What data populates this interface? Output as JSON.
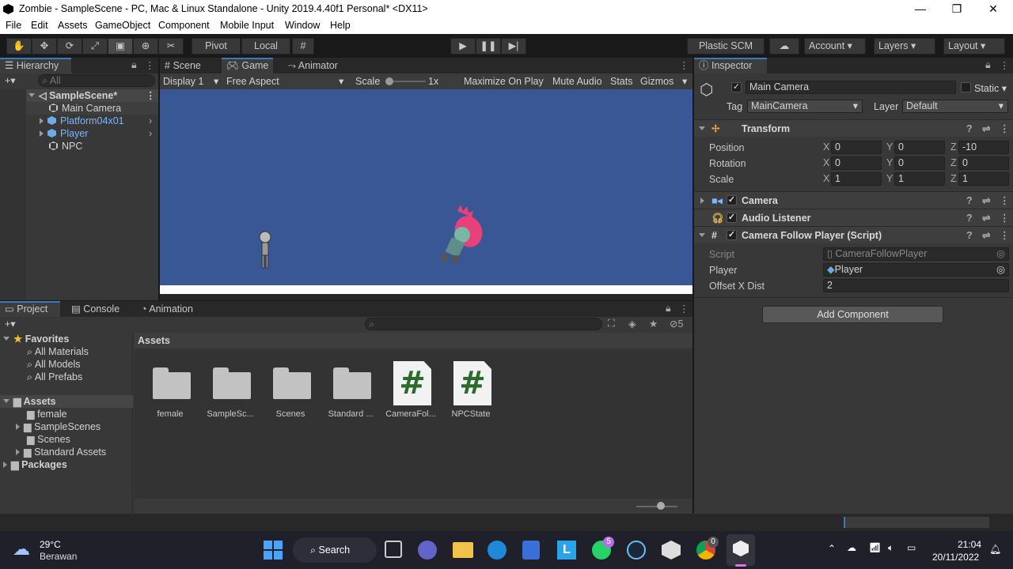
{
  "window": {
    "title": "Zombie - SampleScene - PC, Mac & Linux Standalone - Unity 2019.4.40f1 Personal* <DX11>",
    "minimize": "—",
    "maximize": "❐",
    "close": "✕"
  },
  "menu": [
    "File",
    "Edit",
    "Assets",
    "GameObject",
    "Component",
    "Mobile Input",
    "Window",
    "Help"
  ],
  "toolbar": {
    "pivot": "Pivot",
    "local": "Local",
    "plastic": "Plastic SCM",
    "account": "Account",
    "layers": "Layers",
    "layout": "Layout"
  },
  "hierarchy": {
    "tab": "Hierarchy",
    "search_placeholder": "All",
    "scene": "SampleScene*",
    "items": [
      {
        "label": "Main Camera",
        "prefab": false
      },
      {
        "label": "Platform04x01",
        "prefab": true
      },
      {
        "label": "Player",
        "prefab": true
      },
      {
        "label": "NPC",
        "prefab": false
      }
    ]
  },
  "center_tabs": [
    "Scene",
    "Game",
    "Animator"
  ],
  "game_toolbar": {
    "display": "Display 1",
    "aspect": "Free Aspect",
    "scale_label": "Scale",
    "scale_value": "1x",
    "maximize": "Maximize On Play",
    "mute": "Mute Audio",
    "stats": "Stats",
    "gizmos": "Gizmos"
  },
  "game_view": {
    "sky_color": "#3a5795",
    "ground_color": "#ffffff"
  },
  "project": {
    "tabs": [
      "Project",
      "Console",
      "Animation"
    ],
    "hidden_count": "5",
    "favorites": "Favorites",
    "favorites_items": [
      "All Materials",
      "All Models",
      "All Prefabs"
    ],
    "assets_root": "Assets",
    "assets_tree": [
      "female",
      "SampleScenes",
      "Scenes",
      "Standard Assets"
    ],
    "packages": "Packages",
    "breadcrumb": "Assets",
    "grid": [
      {
        "label": "female",
        "kind": "folder"
      },
      {
        "label": "SampleSc...",
        "kind": "folder"
      },
      {
        "label": "Scenes",
        "kind": "folder"
      },
      {
        "label": "Standard ...",
        "kind": "folder"
      },
      {
        "label": "CameraFol...",
        "kind": "script"
      },
      {
        "label": "NPCState",
        "kind": "script"
      }
    ]
  },
  "inspector": {
    "tab": "Inspector",
    "object_name": "Main Camera",
    "static": "Static",
    "tag_label": "Tag",
    "tag": "MainCamera",
    "layer_label": "Layer",
    "layer": "Default",
    "transform": {
      "title": "Transform",
      "position": {
        "label": "Position",
        "x": "0",
        "y": "0",
        "z": "-10"
      },
      "rotation": {
        "label": "Rotation",
        "x": "0",
        "y": "0",
        "z": "0"
      },
      "scale": {
        "label": "Scale",
        "x": "1",
        "y": "1",
        "z": "1"
      }
    },
    "camera": "Camera",
    "audio_listener": "Audio Listener",
    "script_comp": {
      "title": "Camera Follow Player (Script)",
      "script_label": "Script",
      "script_value": "CameraFollowPlayer",
      "player_label": "Player",
      "player_value": "Player",
      "offset_label": "Offset X Dist",
      "offset_value": "2"
    },
    "add_component": "Add Component"
  },
  "taskbar": {
    "temp": "29°C",
    "weather": "Berawan",
    "search": "Search",
    "time": "21:04",
    "date": "20/11/2022",
    "whatsapp_badge": "5",
    "chrome_badge": "0"
  }
}
